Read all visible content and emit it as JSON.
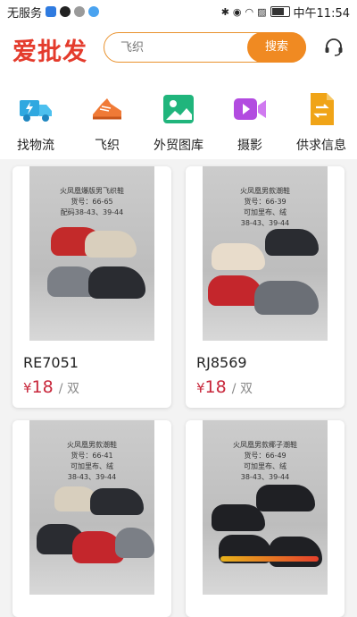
{
  "status_bar": {
    "carrier": "无服务",
    "time": "中午11:54"
  },
  "header": {
    "logo": "爱批发",
    "search_placeholder": "飞织",
    "search_button": "搜索"
  },
  "categories": [
    {
      "label": "找物流",
      "icon": "logistics-truck-icon",
      "color": "#2fa8e0"
    },
    {
      "label": "飞织",
      "icon": "sneaker-icon",
      "color": "#f07a36"
    },
    {
      "label": "外贸图库",
      "icon": "image-gallery-icon",
      "color": "#20b57c"
    },
    {
      "label": "摄影",
      "icon": "video-camera-icon",
      "color": "#b24be0"
    },
    {
      "label": "供求信息",
      "icon": "document-exchange-icon",
      "color": "#f0a417"
    }
  ],
  "products": [
    {
      "note": [
        "火凤凰爆版男飞织鞋",
        "货号：66-65",
        "配码38-43、39-44"
      ],
      "sku": "RE7051",
      "currency": "¥",
      "price": "18",
      "unit": "/ 双"
    },
    {
      "note": [
        "火凤凰男款潮鞋",
        "货号：66-39",
        "可加里布、绒",
        "38-43、39-44"
      ],
      "sku": "RJ8569",
      "currency": "¥",
      "price": "18",
      "unit": "/ 双"
    },
    {
      "note": [
        "火凤凰男款潮鞋",
        "货号：66-41",
        "可加里布、绒",
        "38-43、39-44"
      ]
    },
    {
      "note": [
        "火凤凰男款椰子潮鞋",
        "货号：66-49",
        "可加里布、绒",
        "38-43、39-44"
      ]
    }
  ],
  "colors": {
    "accent": "#f08a22",
    "price": "#c8273b",
    "logo": "#e43b2c"
  }
}
